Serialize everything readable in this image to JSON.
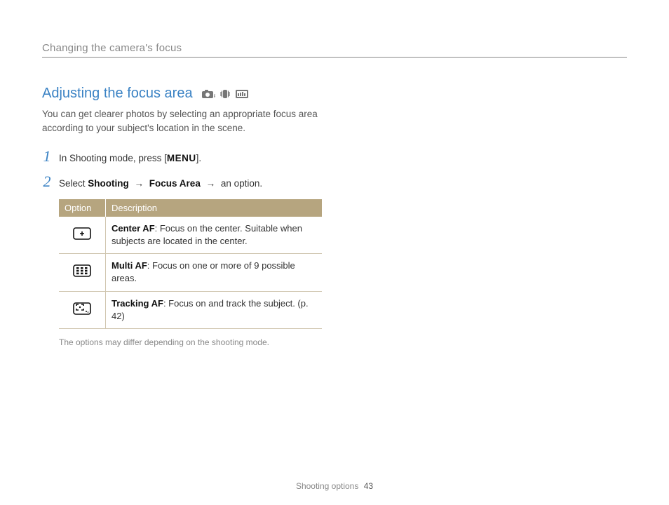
{
  "breadcrumb": "Changing the camera's focus",
  "section_title": "Adjusting the focus area",
  "intro": "You can get clearer photos by selecting an appropriate focus area according to your subject's location in the scene.",
  "steps": {
    "s1": {
      "num": "1",
      "pre": "In Shooting mode, press [",
      "key": "MENU",
      "post": "]."
    },
    "s2": {
      "num": "2",
      "pre": "Select ",
      "b1": "Shooting",
      "arrow1": "→",
      "b2": "Focus Area",
      "arrow2": "→",
      "post": " an option."
    }
  },
  "table": {
    "head_option": "Option",
    "head_desc": "Description",
    "rows": [
      {
        "icon": "center-af",
        "b": "Center AF",
        "d": ": Focus on the center. Suitable when subjects are located in the center."
      },
      {
        "icon": "multi-af",
        "b": "Multi AF",
        "d": ": Focus on one or more of 9 possible areas."
      },
      {
        "icon": "tracking-af",
        "b": "Tracking AF",
        "d": ": Focus on and track the subject. (p. 42)"
      }
    ]
  },
  "footnote": "The options may differ depending on the shooting mode.",
  "footer": {
    "section": "Shooting options",
    "page": "43"
  }
}
